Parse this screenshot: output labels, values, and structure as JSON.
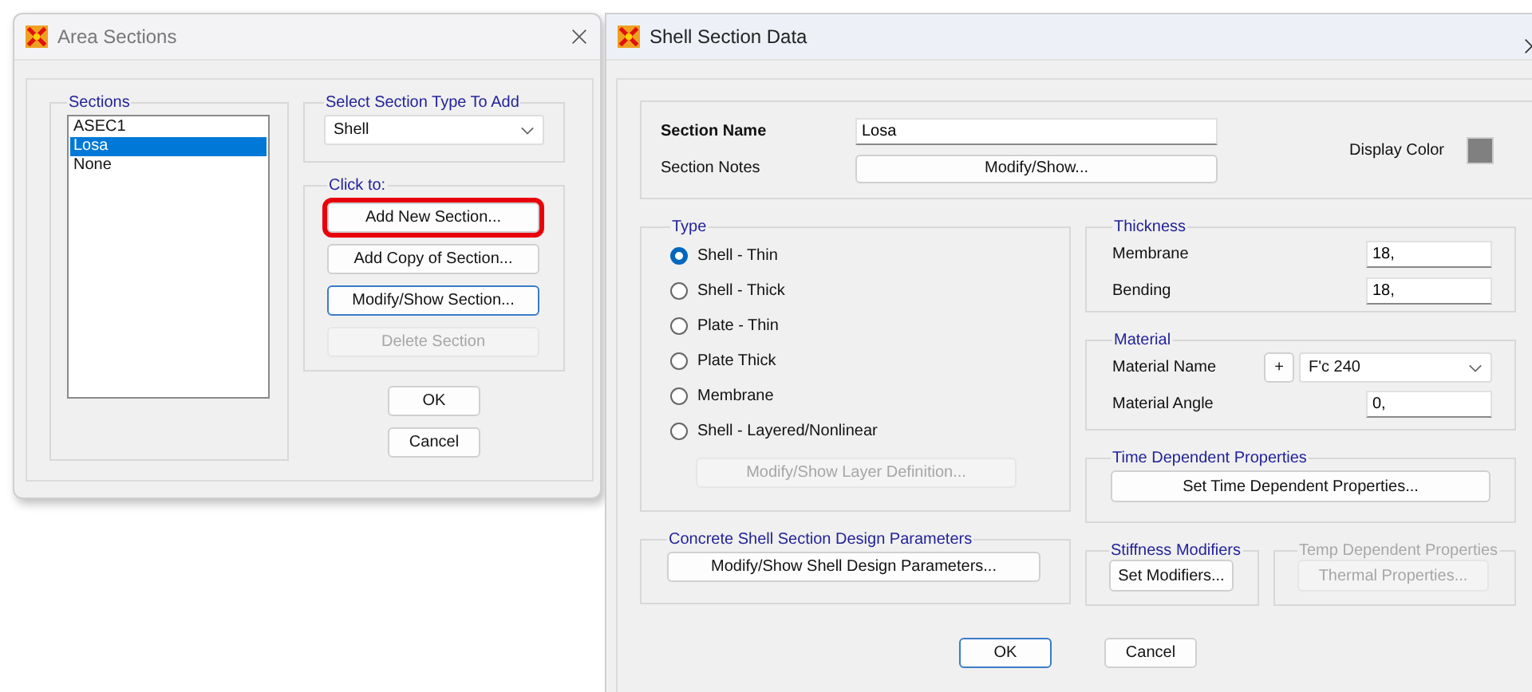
{
  "area_sections": {
    "title": "Area Sections",
    "sections_group": {
      "label": "Sections",
      "items": [
        {
          "label": "ASEC1",
          "selected": false
        },
        {
          "label": "Losa",
          "selected": true
        },
        {
          "label": "None",
          "selected": false
        }
      ]
    },
    "type_group": {
      "label": "Select Section Type To Add",
      "value": "Shell"
    },
    "click_group": {
      "label": "Click to:",
      "buttons": [
        {
          "label": "Add New Section...",
          "highlighted": true,
          "focused": false,
          "disabled": false
        },
        {
          "label": "Add Copy of Section...",
          "highlighted": false,
          "focused": false,
          "disabled": false
        },
        {
          "label": "Modify/Show Section...",
          "highlighted": false,
          "focused": true,
          "disabled": false
        },
        {
          "label": "Delete Section",
          "highlighted": false,
          "focused": false,
          "disabled": true
        }
      ]
    },
    "buttons": [
      {
        "label": "OK"
      },
      {
        "label": "Cancel"
      }
    ]
  },
  "shell_section_data": {
    "title": "Shell Section Data",
    "section_name": {
      "label": "Section Name",
      "value": "Losa"
    },
    "section_notes": {
      "label": "Section Notes",
      "button": "Modify/Show..."
    },
    "display_color": {
      "label": "Display Color",
      "color": "#808080"
    },
    "type_group": {
      "label": "Type",
      "options": [
        {
          "label": "Shell - Thin",
          "selected": true
        },
        {
          "label": "Shell - Thick",
          "selected": false
        },
        {
          "label": "Plate - Thin",
          "selected": false
        },
        {
          "label": "Plate Thick",
          "selected": false
        },
        {
          "label": "Membrane",
          "selected": false
        },
        {
          "label": "Shell - Layered/Nonlinear",
          "selected": false
        }
      ],
      "layer_button": {
        "label": "Modify/Show Layer Definition...",
        "disabled": true
      }
    },
    "concrete_group": {
      "label": "Concrete Shell Section Design Parameters",
      "button": "Modify/Show Shell Design Parameters..."
    },
    "thickness": {
      "label": "Thickness",
      "fields": [
        {
          "label": "Membrane",
          "value": "18,"
        },
        {
          "label": "Bending",
          "value": "18,"
        }
      ]
    },
    "material": {
      "label": "Material",
      "name_label": "Material Name",
      "add_button": "+",
      "name_value": "F'c 240",
      "angle_label": "Material Angle",
      "angle_value": "0,"
    },
    "time_dependent": {
      "label": "Time Dependent Properties",
      "button": "Set Time Dependent Properties..."
    },
    "stiffness": {
      "label": "Stiffness Modifiers",
      "button": "Set Modifiers..."
    },
    "temp_dependent": {
      "label": "Temp Dependent Properties",
      "button": "Thermal Properties...",
      "disabled": true
    },
    "buttons": [
      {
        "label": "OK",
        "focused": true
      },
      {
        "label": "Cancel",
        "focused": false
      }
    ]
  }
}
